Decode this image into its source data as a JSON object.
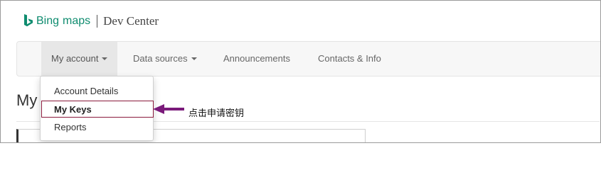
{
  "brand": {
    "bing": "Bing",
    "maps": "maps",
    "dev_center": "Dev Center",
    "logo_color": "#0f8c6f"
  },
  "navbar": {
    "items": [
      {
        "label": "My account",
        "has_caret": true,
        "active": true
      },
      {
        "label": "Data sources",
        "has_caret": true,
        "active": false
      },
      {
        "label": "Announcements",
        "has_caret": false,
        "active": false
      },
      {
        "label": "Contacts & Info",
        "has_caret": false,
        "active": false
      }
    ]
  },
  "page": {
    "heading_partial": "My"
  },
  "dropdown": {
    "items": [
      {
        "label": "Account Details",
        "highlighted": false
      },
      {
        "label": "My Keys",
        "highlighted": true
      },
      {
        "label": "Reports",
        "highlighted": false
      }
    ]
  },
  "annotation": {
    "text": "点击申请密钥",
    "arrow_color": "#7a1a7a",
    "box_color": "#8a1a3c"
  }
}
